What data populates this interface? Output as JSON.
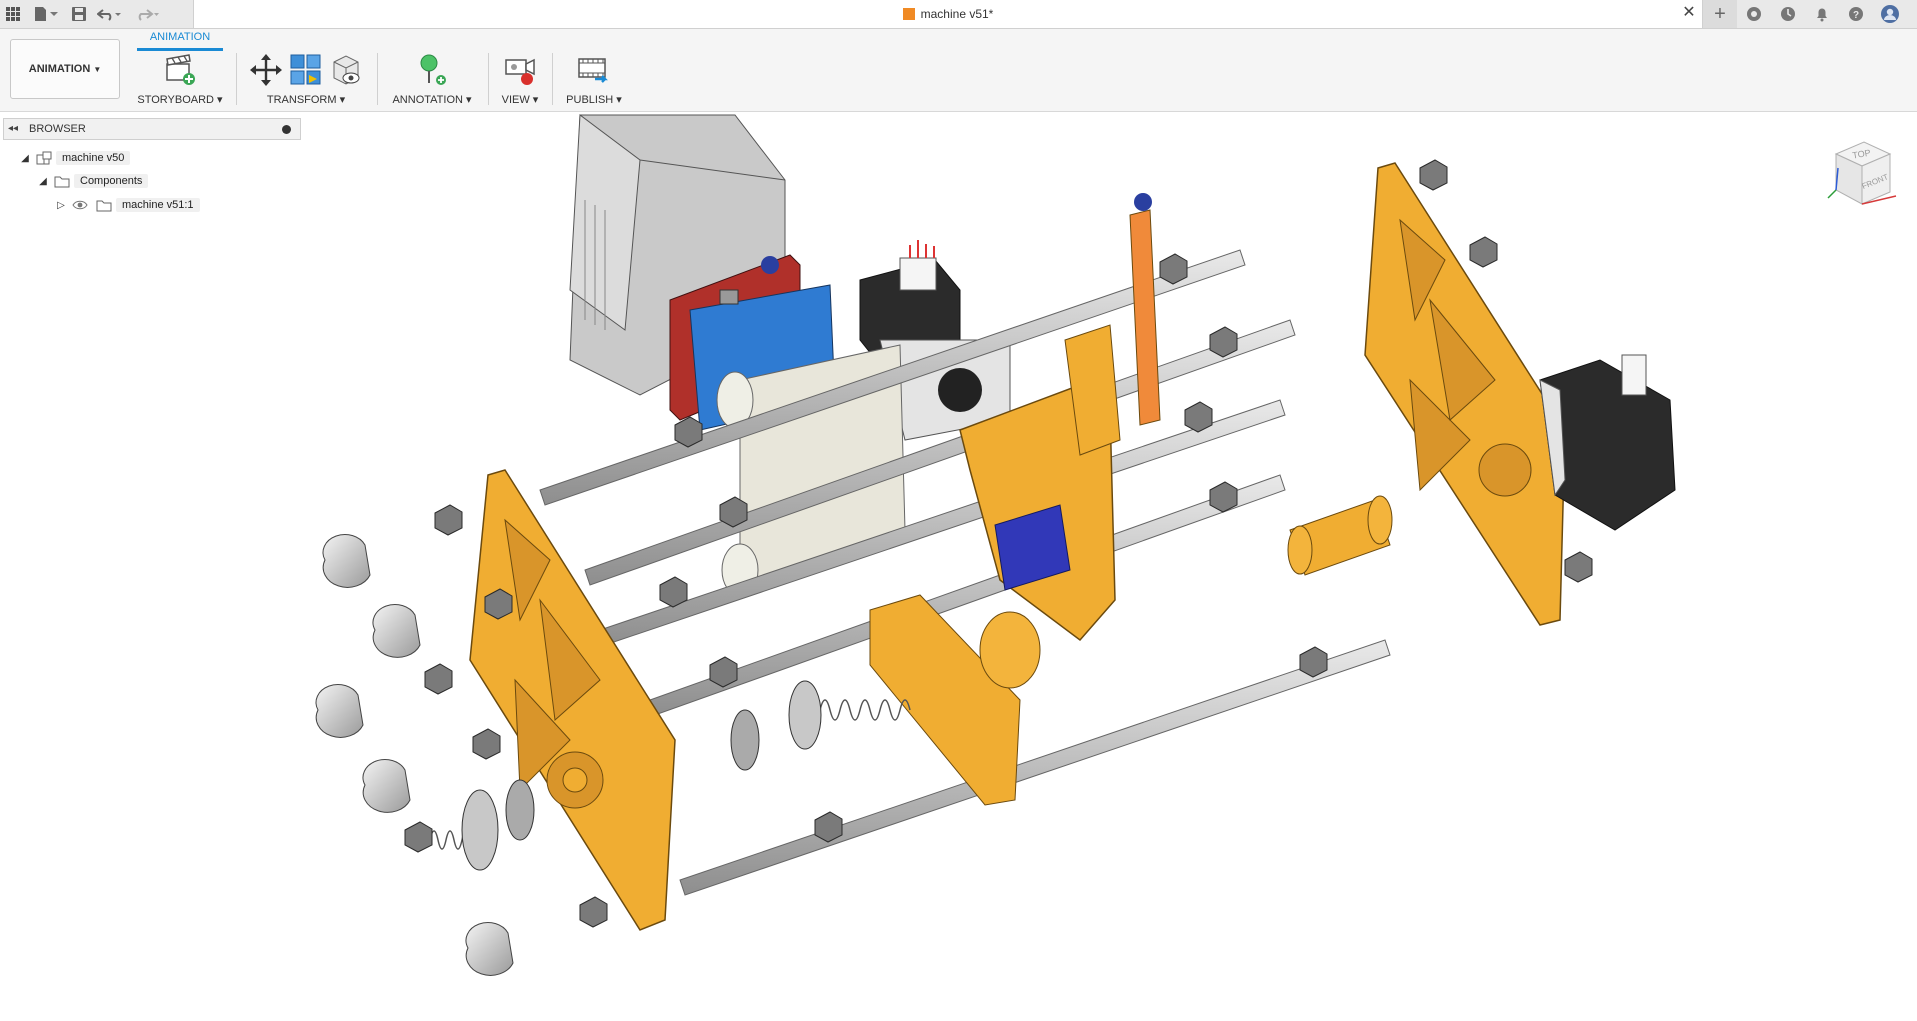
{
  "app": {
    "document_title": "machine v51*"
  },
  "icons": {
    "top_left": [
      "grid-icon",
      "file-icon",
      "save-icon",
      "undo-icon",
      "redo-icon"
    ],
    "top_right": [
      "new-tab-icon",
      "extensions-icon",
      "job-status-icon",
      "notifications-icon",
      "help-icon",
      "user-avatar-icon"
    ]
  },
  "toolbar": {
    "workspace_label": "ANIMATION",
    "active_tab": "ANIMATION",
    "groups": [
      {
        "label": "STORYBOARD ▾"
      },
      {
        "label": "TRANSFORM ▾"
      },
      {
        "label": "ANNOTATION ▾"
      },
      {
        "label": "VIEW ▾"
      },
      {
        "label": "PUBLISH ▾"
      }
    ]
  },
  "browser": {
    "title": "BROWSER",
    "nodes": [
      {
        "label": "machine v50"
      },
      {
        "label": "Components"
      },
      {
        "label": "machine v51:1"
      }
    ]
  },
  "viewcube": {
    "top": "TOP",
    "front": "FRONT"
  },
  "colors": {
    "accent": "#1a8ad4",
    "part_orange": "#f0ad32",
    "steel": "#bdbdbd"
  }
}
